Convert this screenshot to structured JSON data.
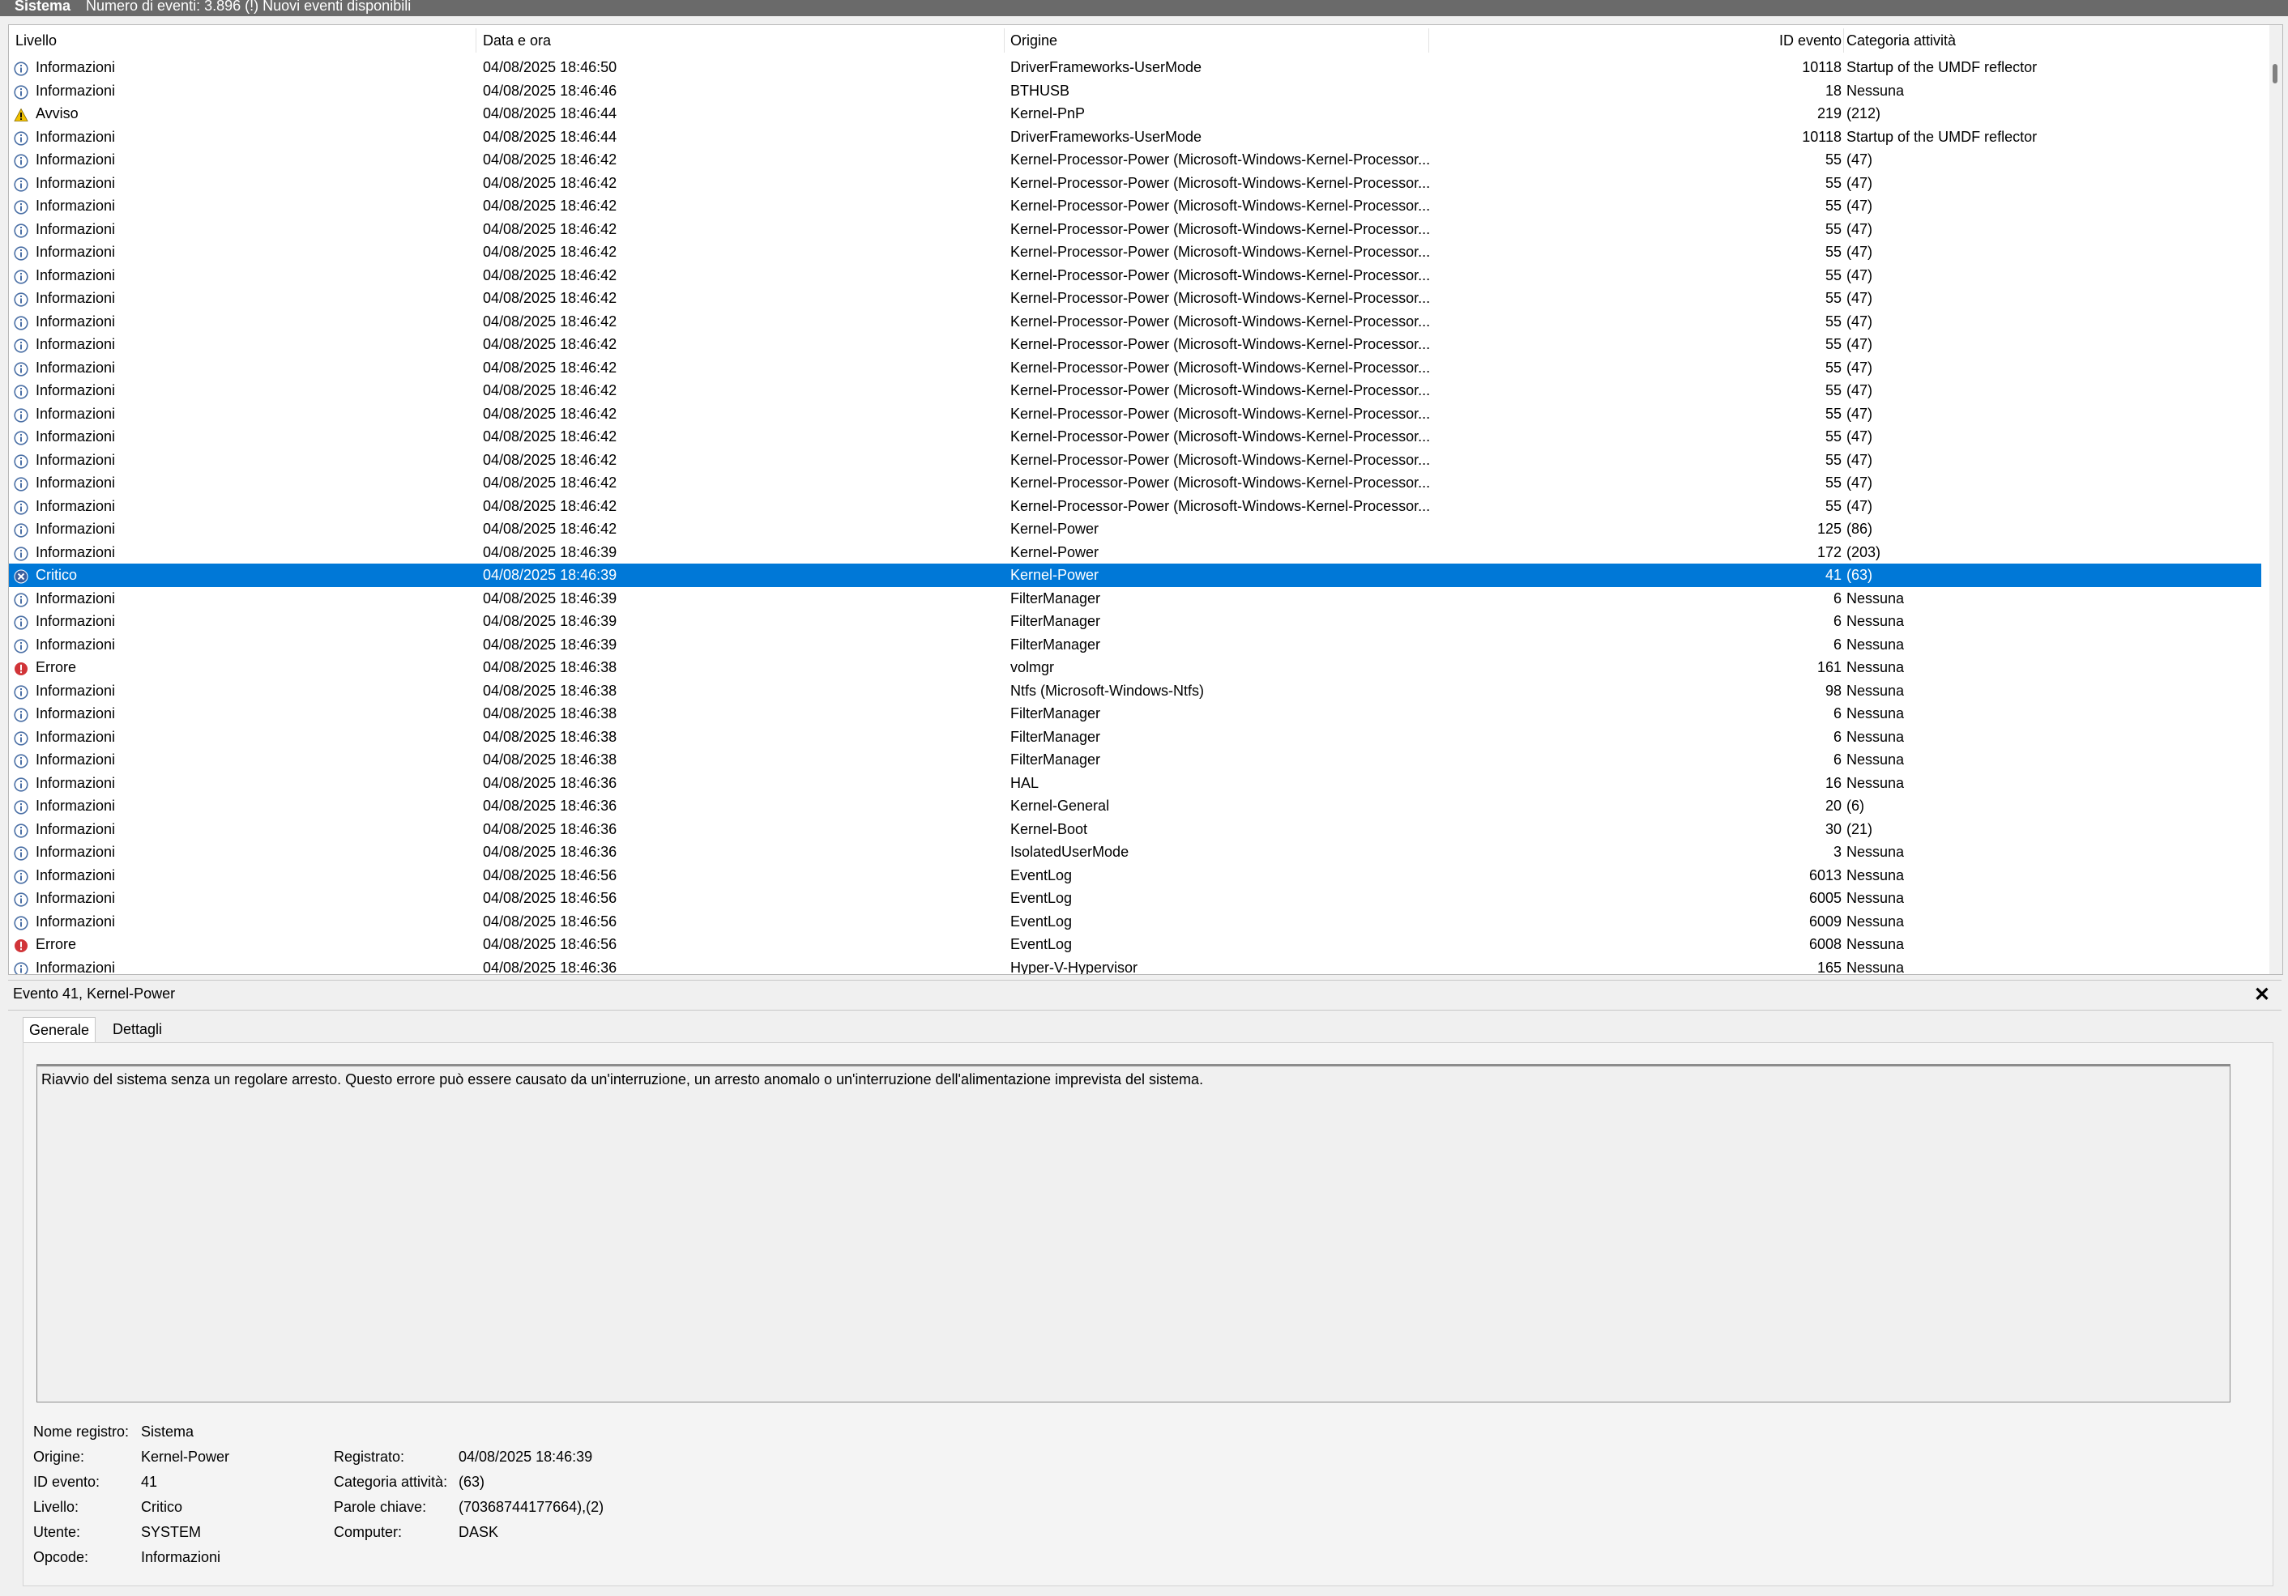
{
  "header": {
    "log_title": "Sistema",
    "event_count": "Numero di eventi: 3.896 (!) Nuovi eventi disponibili"
  },
  "columns": {
    "level": "Livello",
    "date": "Data e ora",
    "source": "Origine",
    "event_id": "ID evento",
    "category": "Categoria attività"
  },
  "events": [
    {
      "level": "Informazioni",
      "icon": "info-icon",
      "date": "04/08/2025 18:46:50",
      "source": "DriverFrameworks-UserMode",
      "id": "10118",
      "category": "Startup of the UMDF reflector"
    },
    {
      "level": "Informazioni",
      "icon": "info-icon",
      "date": "04/08/2025 18:46:46",
      "source": "BTHUSB",
      "id": "18",
      "category": "Nessuna"
    },
    {
      "level": "Avviso",
      "icon": "warning-icon",
      "date": "04/08/2025 18:46:44",
      "source": "Kernel-PnP",
      "id": "219",
      "category": "(212)"
    },
    {
      "level": "Informazioni",
      "icon": "info-icon",
      "date": "04/08/2025 18:46:44",
      "source": "DriverFrameworks-UserMode",
      "id": "10118",
      "category": "Startup of the UMDF reflector"
    },
    {
      "level": "Informazioni",
      "icon": "info-icon",
      "date": "04/08/2025 18:46:42",
      "source": "Kernel-Processor-Power (Microsoft-Windows-Kernel-Processor...",
      "id": "55",
      "category": "(47)"
    },
    {
      "level": "Informazioni",
      "icon": "info-icon",
      "date": "04/08/2025 18:46:42",
      "source": "Kernel-Processor-Power (Microsoft-Windows-Kernel-Processor...",
      "id": "55",
      "category": "(47)"
    },
    {
      "level": "Informazioni",
      "icon": "info-icon",
      "date": "04/08/2025 18:46:42",
      "source": "Kernel-Processor-Power (Microsoft-Windows-Kernel-Processor...",
      "id": "55",
      "category": "(47)"
    },
    {
      "level": "Informazioni",
      "icon": "info-icon",
      "date": "04/08/2025 18:46:42",
      "source": "Kernel-Processor-Power (Microsoft-Windows-Kernel-Processor...",
      "id": "55",
      "category": "(47)"
    },
    {
      "level": "Informazioni",
      "icon": "info-icon",
      "date": "04/08/2025 18:46:42",
      "source": "Kernel-Processor-Power (Microsoft-Windows-Kernel-Processor...",
      "id": "55",
      "category": "(47)"
    },
    {
      "level": "Informazioni",
      "icon": "info-icon",
      "date": "04/08/2025 18:46:42",
      "source": "Kernel-Processor-Power (Microsoft-Windows-Kernel-Processor...",
      "id": "55",
      "category": "(47)"
    },
    {
      "level": "Informazioni",
      "icon": "info-icon",
      "date": "04/08/2025 18:46:42",
      "source": "Kernel-Processor-Power (Microsoft-Windows-Kernel-Processor...",
      "id": "55",
      "category": "(47)"
    },
    {
      "level": "Informazioni",
      "icon": "info-icon",
      "date": "04/08/2025 18:46:42",
      "source": "Kernel-Processor-Power (Microsoft-Windows-Kernel-Processor...",
      "id": "55",
      "category": "(47)"
    },
    {
      "level": "Informazioni",
      "icon": "info-icon",
      "date": "04/08/2025 18:46:42",
      "source": "Kernel-Processor-Power (Microsoft-Windows-Kernel-Processor...",
      "id": "55",
      "category": "(47)"
    },
    {
      "level": "Informazioni",
      "icon": "info-icon",
      "date": "04/08/2025 18:46:42",
      "source": "Kernel-Processor-Power (Microsoft-Windows-Kernel-Processor...",
      "id": "55",
      "category": "(47)"
    },
    {
      "level": "Informazioni",
      "icon": "info-icon",
      "date": "04/08/2025 18:46:42",
      "source": "Kernel-Processor-Power (Microsoft-Windows-Kernel-Processor...",
      "id": "55",
      "category": "(47)"
    },
    {
      "level": "Informazioni",
      "icon": "info-icon",
      "date": "04/08/2025 18:46:42",
      "source": "Kernel-Processor-Power (Microsoft-Windows-Kernel-Processor...",
      "id": "55",
      "category": "(47)"
    },
    {
      "level": "Informazioni",
      "icon": "info-icon",
      "date": "04/08/2025 18:46:42",
      "source": "Kernel-Processor-Power (Microsoft-Windows-Kernel-Processor...",
      "id": "55",
      "category": "(47)"
    },
    {
      "level": "Informazioni",
      "icon": "info-icon",
      "date": "04/08/2025 18:46:42",
      "source": "Kernel-Processor-Power (Microsoft-Windows-Kernel-Processor...",
      "id": "55",
      "category": "(47)"
    },
    {
      "level": "Informazioni",
      "icon": "info-icon",
      "date": "04/08/2025 18:46:42",
      "source": "Kernel-Processor-Power (Microsoft-Windows-Kernel-Processor...",
      "id": "55",
      "category": "(47)"
    },
    {
      "level": "Informazioni",
      "icon": "info-icon",
      "date": "04/08/2025 18:46:42",
      "source": "Kernel-Processor-Power (Microsoft-Windows-Kernel-Processor...",
      "id": "55",
      "category": "(47)"
    },
    {
      "level": "Informazioni",
      "icon": "info-icon",
      "date": "04/08/2025 18:46:42",
      "source": "Kernel-Power",
      "id": "125",
      "category": "(86)"
    },
    {
      "level": "Informazioni",
      "icon": "info-icon",
      "date": "04/08/2025 18:46:39",
      "source": "Kernel-Power",
      "id": "172",
      "category": "(203)"
    },
    {
      "level": "Critico",
      "icon": "critical-icon",
      "date": "04/08/2025 18:46:39",
      "source": "Kernel-Power",
      "id": "41",
      "category": "(63)",
      "selected": true
    },
    {
      "level": "Informazioni",
      "icon": "info-icon",
      "date": "04/08/2025 18:46:39",
      "source": "FilterManager",
      "id": "6",
      "category": "Nessuna"
    },
    {
      "level": "Informazioni",
      "icon": "info-icon",
      "date": "04/08/2025 18:46:39",
      "source": "FilterManager",
      "id": "6",
      "category": "Nessuna"
    },
    {
      "level": "Informazioni",
      "icon": "info-icon",
      "date": "04/08/2025 18:46:39",
      "source": "FilterManager",
      "id": "6",
      "category": "Nessuna"
    },
    {
      "level": "Errore",
      "icon": "error-icon",
      "date": "04/08/2025 18:46:38",
      "source": "volmgr",
      "id": "161",
      "category": "Nessuna"
    },
    {
      "level": "Informazioni",
      "icon": "info-icon",
      "date": "04/08/2025 18:46:38",
      "source": "Ntfs (Microsoft-Windows-Ntfs)",
      "id": "98",
      "category": "Nessuna"
    },
    {
      "level": "Informazioni",
      "icon": "info-icon",
      "date": "04/08/2025 18:46:38",
      "source": "FilterManager",
      "id": "6",
      "category": "Nessuna"
    },
    {
      "level": "Informazioni",
      "icon": "info-icon",
      "date": "04/08/2025 18:46:38",
      "source": "FilterManager",
      "id": "6",
      "category": "Nessuna"
    },
    {
      "level": "Informazioni",
      "icon": "info-icon",
      "date": "04/08/2025 18:46:38",
      "source": "FilterManager",
      "id": "6",
      "category": "Nessuna"
    },
    {
      "level": "Informazioni",
      "icon": "info-icon",
      "date": "04/08/2025 18:46:36",
      "source": "HAL",
      "id": "16",
      "category": "Nessuna"
    },
    {
      "level": "Informazioni",
      "icon": "info-icon",
      "date": "04/08/2025 18:46:36",
      "source": "Kernel-General",
      "id": "20",
      "category": "(6)"
    },
    {
      "level": "Informazioni",
      "icon": "info-icon",
      "date": "04/08/2025 18:46:36",
      "source": "Kernel-Boot",
      "id": "30",
      "category": "(21)"
    },
    {
      "level": "Informazioni",
      "icon": "info-icon",
      "date": "04/08/2025 18:46:36",
      "source": "IsolatedUserMode",
      "id": "3",
      "category": "Nessuna"
    },
    {
      "level": "Informazioni",
      "icon": "info-icon",
      "date": "04/08/2025 18:46:56",
      "source": "EventLog",
      "id": "6013",
      "category": "Nessuna"
    },
    {
      "level": "Informazioni",
      "icon": "info-icon",
      "date": "04/08/2025 18:46:56",
      "source": "EventLog",
      "id": "6005",
      "category": "Nessuna"
    },
    {
      "level": "Informazioni",
      "icon": "info-icon",
      "date": "04/08/2025 18:46:56",
      "source": "EventLog",
      "id": "6009",
      "category": "Nessuna"
    },
    {
      "level": "Errore",
      "icon": "error-icon",
      "date": "04/08/2025 18:46:56",
      "source": "EventLog",
      "id": "6008",
      "category": "Nessuna"
    },
    {
      "level": "Informazioni",
      "icon": "info-icon",
      "date": "04/08/2025 18:46:36",
      "source": "Hyper-V-Hypervisor",
      "id": "165",
      "category": "Nessuna"
    }
  ],
  "detail": {
    "title": "Evento 41, Kernel-Power",
    "close_symbol": "✕",
    "tabs": [
      "Generale",
      "Dettagli"
    ],
    "description": "Riavvio del sistema senza un regolare arresto. Questo errore può essere causato da un'interruzione, un arresto anomalo o un'interruzione dell'alimentazione imprevista del sistema.",
    "props": {
      "log_name_label": "Nome registro:",
      "log_name": "Sistema",
      "source_label": "Origine:",
      "source": "Kernel-Power",
      "logged_label": "Registrato:",
      "logged": "04/08/2025 18:46:39",
      "event_id_label": "ID evento:",
      "event_id": "41",
      "task_label": "Categoria attività:",
      "task": "(63)",
      "level_label": "Livello:",
      "level": "Critico",
      "keywords_label": "Parole chiave:",
      "keywords": "(70368744177664),(2)",
      "user_label": "Utente:",
      "user": "SYSTEM",
      "computer_label": "Computer:",
      "computer": "DASK",
      "opcode_label": "Opcode:",
      "opcode": "Informazioni"
    }
  },
  "colors": {
    "selection": "#0078d7",
    "info_icon": "#4a6fa5",
    "warning_icon": "#f2c200",
    "error_icon": "#d13438",
    "critical_icon": "#3b5f9e"
  }
}
